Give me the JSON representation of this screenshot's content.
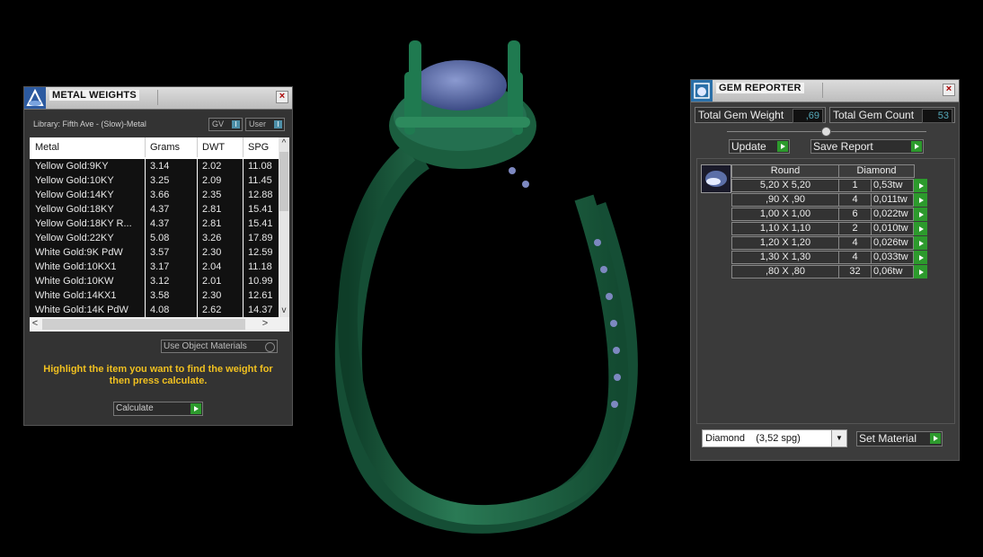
{
  "metal_weights": {
    "title": "METAL WEIGHTS",
    "library": "Library: Fifth Ave - (Slow)-Metal",
    "gv_label": "GV",
    "user_label": "User",
    "columns": [
      "Metal",
      "Grams",
      "DWT",
      "SPG"
    ],
    "rows": [
      [
        "Yellow Gold:9KY",
        "3.14",
        "2.02",
        "11.08"
      ],
      [
        "Yellow Gold:10KY",
        "3.25",
        "2.09",
        "11.45"
      ],
      [
        "Yellow Gold:14KY",
        "3.66",
        "2.35",
        "12.88"
      ],
      [
        "Yellow Gold:18KY",
        "4.37",
        "2.81",
        "15.41"
      ],
      [
        "Yellow Gold:18KY R...",
        "4.37",
        "2.81",
        "15.41"
      ],
      [
        "Yellow Gold:22KY",
        "5.08",
        "3.26",
        "17.89"
      ],
      [
        "White Gold:9K PdW",
        "3.57",
        "2.30",
        "12.59"
      ],
      [
        "White Gold:10KX1",
        "3.17",
        "2.04",
        "11.18"
      ],
      [
        "White Gold:10KW",
        "3.12",
        "2.01",
        "10.99"
      ],
      [
        "White Gold:14KX1",
        "3.58",
        "2.30",
        "12.61"
      ],
      [
        "White Gold:14K PdW",
        "4.08",
        "2.62",
        "14.37"
      ]
    ],
    "use_object_materials": "Use Object Materials",
    "hint": "Highlight the item you want to find the weight for then press calculate.",
    "calculate": "Calculate"
  },
  "gem_reporter": {
    "title": "GEM REPORTER",
    "total_weight_label": "Total Gem Weight",
    "total_weight_value": ",69",
    "total_count_label": "Total Gem Count",
    "total_count_value": "53",
    "update": "Update",
    "save_report": "Save Report",
    "shape": "Round",
    "material": "Diamond",
    "gems": [
      [
        "5,20 X 5,20",
        "1",
        "0,53tw"
      ],
      [
        ",90 X ,90",
        "4",
        "0,011tw"
      ],
      [
        "1,00 X 1,00",
        "6",
        "0,022tw"
      ],
      [
        "1,10 X 1,10",
        "2",
        "0,010tw"
      ],
      [
        "1,20 X 1,20",
        "4",
        "0,026tw"
      ],
      [
        "1,30 X 1,30",
        "4",
        "0,033tw"
      ],
      [
        ",80 X ,80",
        "32",
        "0,06tw"
      ]
    ],
    "material_select": "Diamond    (3,52 spg)",
    "set_material": "Set Material"
  },
  "colors": {
    "ring_green": "#1f6a48",
    "gem_blue": "#5c6fa8",
    "hint_yellow": "#f0c020",
    "button_green": "#2d9a2d"
  }
}
